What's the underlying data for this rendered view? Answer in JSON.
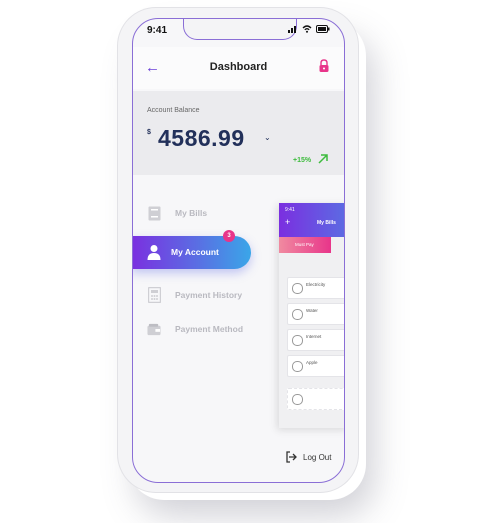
{
  "status": {
    "time": "9:41"
  },
  "header": {
    "title": "Dashboard"
  },
  "balance": {
    "label": "Account Balance",
    "currency": "$",
    "amount": "4586.99",
    "change": "+15%"
  },
  "menu": {
    "items": [
      {
        "label": "My Bills"
      },
      {
        "label": "My Account",
        "badge": "3"
      },
      {
        "label": "Payment History"
      },
      {
        "label": "Payment Method"
      }
    ]
  },
  "preview": {
    "time": "9:41",
    "title": "My Bills",
    "tab": "Must Pay",
    "rows": [
      {
        "name": "Electricity"
      },
      {
        "name": "Water"
      },
      {
        "name": "Internet"
      },
      {
        "name": "Apple"
      }
    ]
  },
  "footer": {
    "logout_label": "Log Out"
  },
  "colors": {
    "accent": "#6a3fd8",
    "balance_text": "#22305a",
    "positive": "#3dbb3d",
    "badge": "#e8358a"
  }
}
